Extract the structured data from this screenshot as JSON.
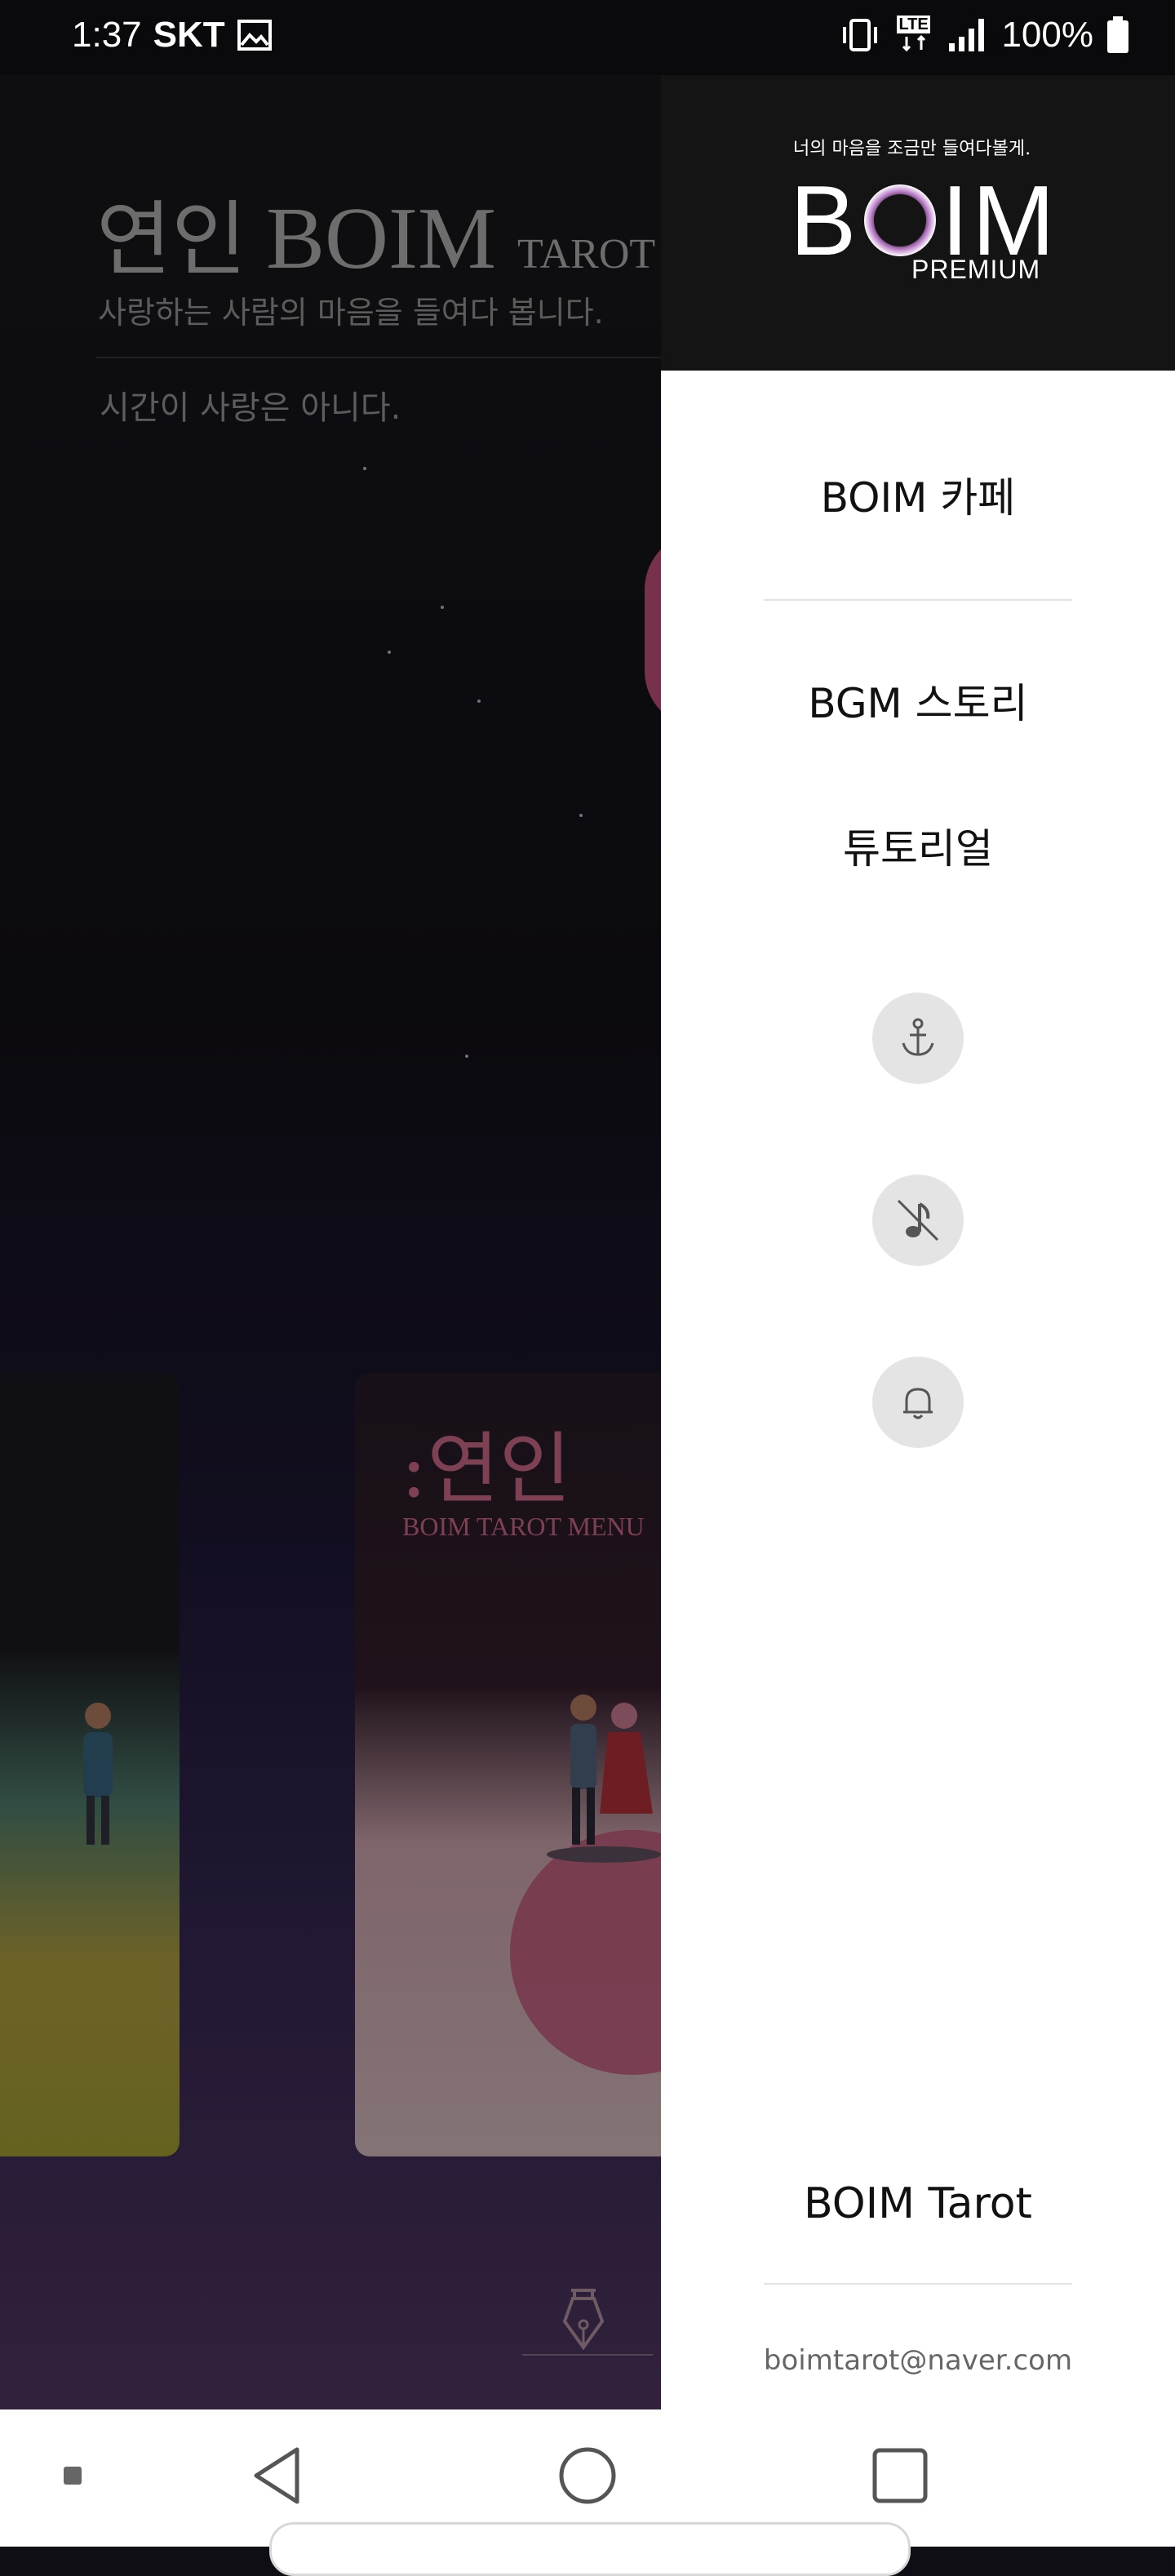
{
  "status_bar": {
    "time": "1:37",
    "carrier": "SKT",
    "battery": "100%",
    "network": "LTE"
  },
  "background_app": {
    "title_korean": "연인",
    "title_brand": "BOIM",
    "title_tag": "TAROT",
    "subtitle": "사랑하는 사람의 마음을 들여다 봅니다.",
    "quote": "시간이 사랑은 아니다.",
    "card": {
      "title": ":연인",
      "subtitle": "BOIM TAROT MENU"
    }
  },
  "drawer": {
    "logo": {
      "tagline": "너의 마음을 조금만 들여다볼게.",
      "word_left": "B",
      "word_right": "IM",
      "edition": "PREMIUM"
    },
    "menu": {
      "cafe": "BOIM 카페",
      "bgm_story": "BGM 스토리",
      "tutorial": "튜토리얼"
    },
    "icon_buttons": [
      "anchor-icon",
      "music-off-icon",
      "bell-icon"
    ],
    "footer": {
      "app_name": "BOIM Tarot",
      "email": "boimtarot@naver.com"
    }
  },
  "colors": {
    "drawer_header_bg": "#141414",
    "drawer_bg": "#ffffff",
    "card_accent": "#e57598",
    "icon_circle_bg": "#e4e4e4"
  }
}
